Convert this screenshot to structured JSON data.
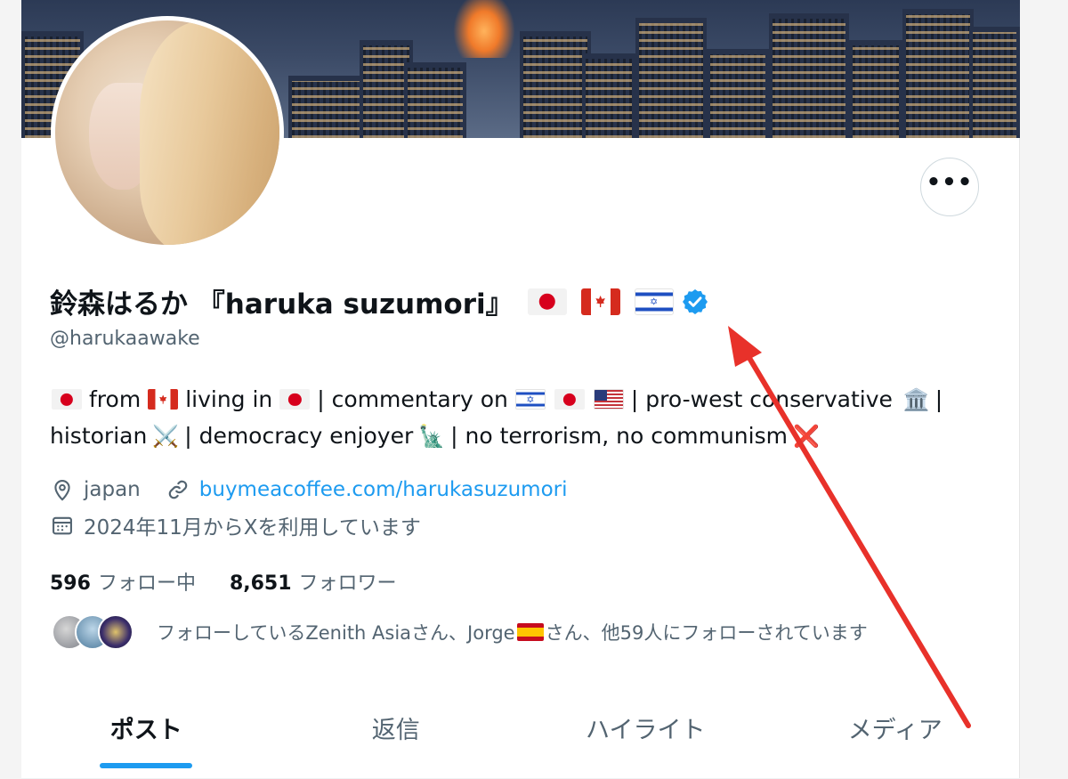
{
  "profile": {
    "display_name": "鈴森はるか 『haruka suzumori』",
    "handle": "@harukaawake",
    "name_icons": [
      "flag-japan-icon",
      "flag-canada-icon",
      "flag-israel-icon",
      "verified-badge-icon"
    ],
    "more_icon": "more-dots-icon",
    "more_label": "•••"
  },
  "bio": {
    "line1": {
      "t1": "from",
      "t2": "living in",
      "t3": "| commentary on",
      "t4": "| pro-west conservative",
      "t5": "|"
    },
    "line2": {
      "t1": "historian",
      "t2": "| democracy enjoyer",
      "t3": "| no terrorism, no communism"
    },
    "emoji": {
      "classical_building": "🏛️",
      "crossed_swords": "⚔️",
      "statue_of_liberty": "🗽",
      "cross_mark": "❌"
    }
  },
  "meta": {
    "location": "japan",
    "location_icon": "location-pin-icon",
    "website": "buymeacoffee.com/harukasuzumori",
    "website_icon": "link-icon",
    "joined": "2024年11月からXを利用しています",
    "joined_icon": "calendar-icon"
  },
  "counts": {
    "following_count": "596",
    "following_label": "フォロー中",
    "followers_count": "8,651",
    "followers_label": "フォロワー"
  },
  "followed_by": {
    "text_before": "フォローしているZenith Asiaさん、Jorge",
    "text_after": "さん、他59人にフォローされています"
  },
  "tabs": [
    {
      "label": "ポスト",
      "active": true
    },
    {
      "label": "返信",
      "active": false
    },
    {
      "label": "ハイライト",
      "active": false
    },
    {
      "label": "メディア",
      "active": false
    }
  ],
  "colors": {
    "accent": "#1d9bf0",
    "annotation_arrow": "#e8312a",
    "text_primary": "#0f1419",
    "text_secondary": "#536471"
  }
}
